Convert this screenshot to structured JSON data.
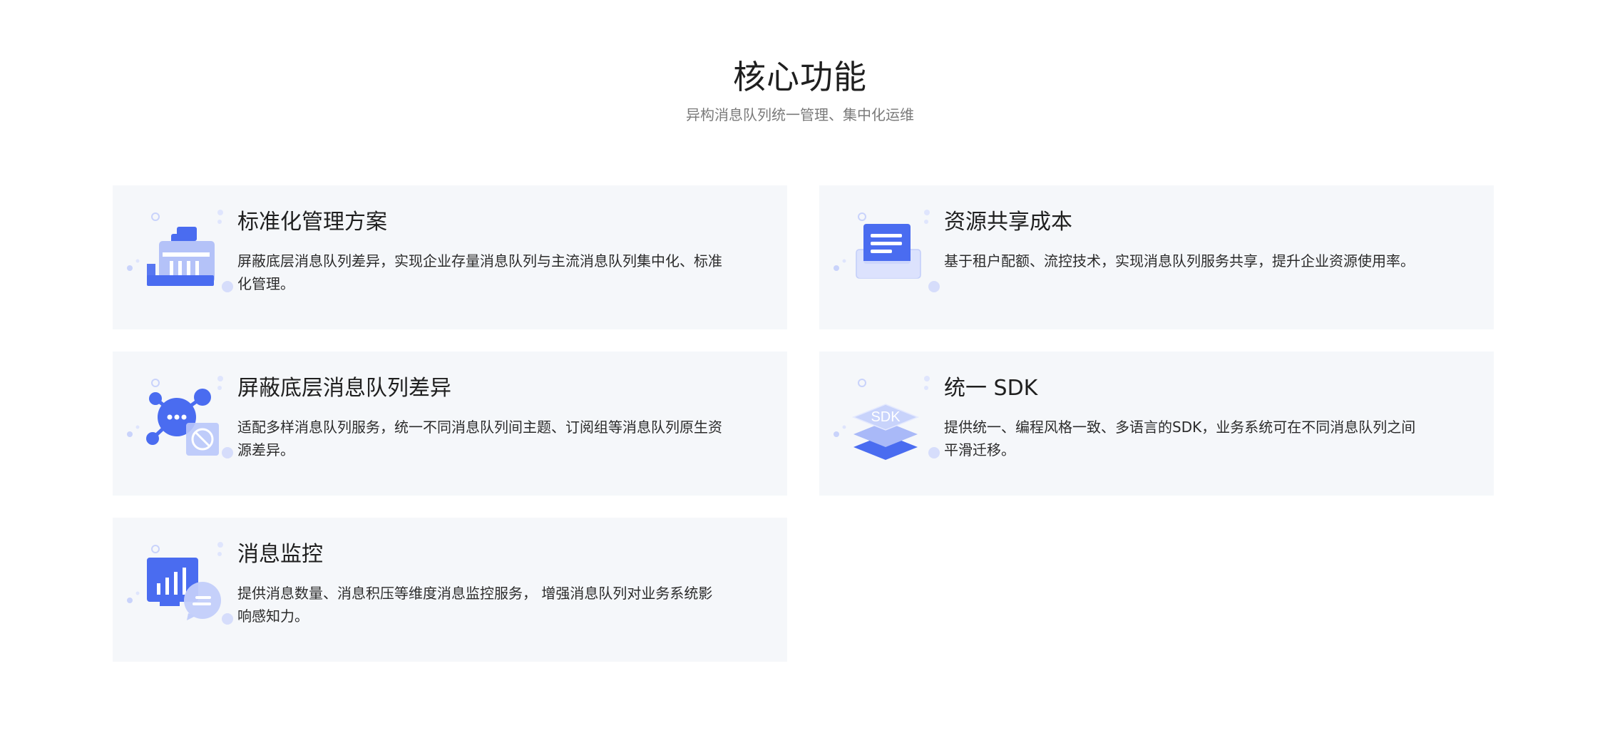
{
  "section": {
    "title": "核心功能",
    "subtitle": "异构消息队列统一管理、集中化运维"
  },
  "features": [
    {
      "title": "标准化管理方案",
      "description": "屏蔽底层消息队列差异，实现企业存量消息队列与主流消息队列集中化、标准化管理。",
      "icon": "server-management-icon"
    },
    {
      "title": "资源共享成本",
      "description": "基于租户配额、流控技术，实现消息队列服务共享，提升企业资源使用率。",
      "icon": "document-share-icon"
    },
    {
      "title": "屏蔽底层消息队列差异",
      "description": "适配多样消息队列服务，统一不同消息队列间主题、订阅组等消息队列原生资源差异。",
      "icon": "network-block-icon"
    },
    {
      "title": "统一 SDK",
      "description": "提供统一、编程风格一致、多语言的SDK，业务系统可在不同消息队列之间平滑迁移。",
      "icon": "sdk-layers-icon"
    },
    {
      "title": "消息监控",
      "description": "提供消息数量、消息积压等维度消息监控服务， 增强消息队列对业务系统影响感知力。",
      "icon": "monitor-chart-icon"
    }
  ],
  "colors": {
    "accent": "#4a6cf0",
    "accent_light": "#c9d3fb",
    "card_background": "#f5f7fa",
    "subtitle": "#7a7a7a"
  }
}
